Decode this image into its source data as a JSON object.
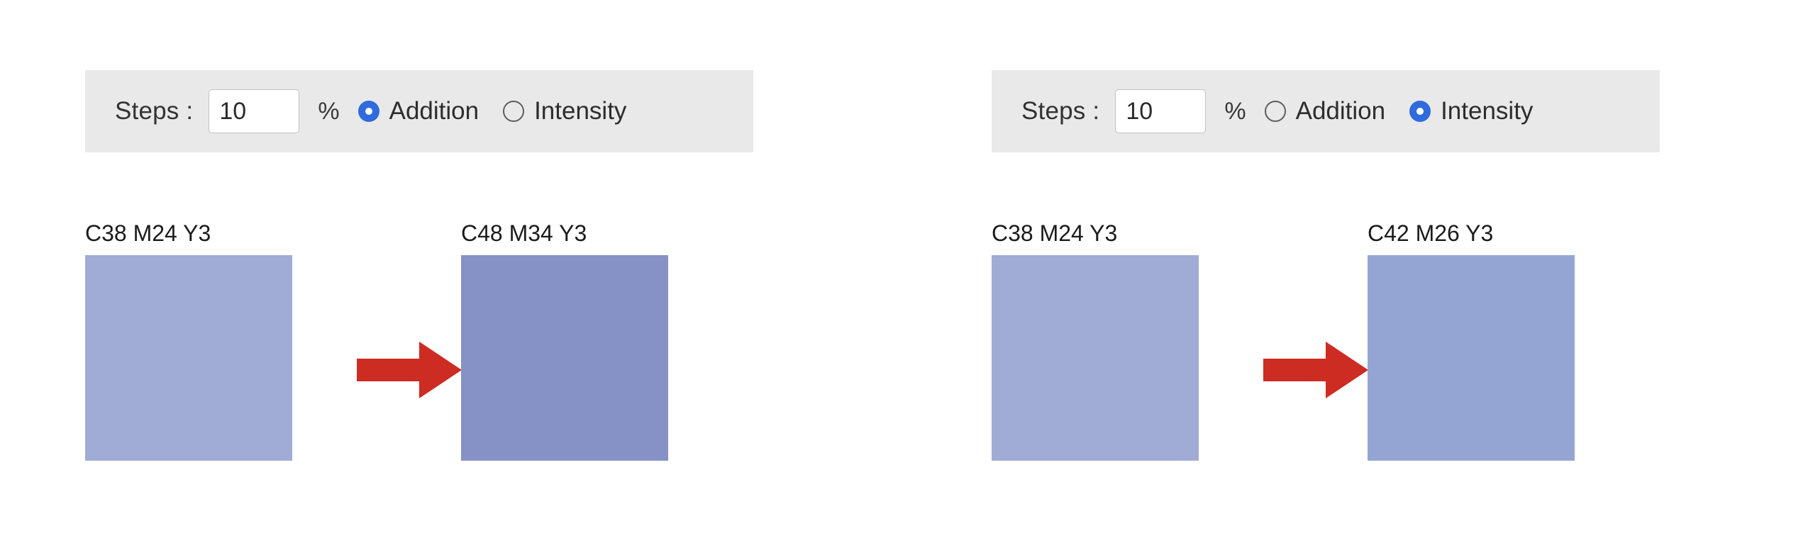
{
  "page": {
    "background": "#ffffff",
    "accent_blue": "#2f6bdc",
    "arrow_red": "#cc2c22",
    "bar_background": "#e9e9e9"
  },
  "panels": [
    {
      "id": "addition-panel",
      "controls": {
        "steps_label": "Steps :",
        "steps_value": "10",
        "steps_placeholder": "10",
        "percent_symbol": "%",
        "options": [
          {
            "label": "Addition",
            "selected": true
          },
          {
            "label": "Intensity",
            "selected": false
          }
        ]
      },
      "swatches": {
        "source": {
          "caption": "C38 M24 Y3",
          "color": "#a0acd5"
        },
        "result": {
          "caption": "C48 M34 Y3",
          "color": "#8692c6"
        },
        "arrow": "arrow-right-icon"
      }
    },
    {
      "id": "intensity-panel",
      "controls": {
        "steps_label": "Steps :",
        "steps_value": "10",
        "steps_placeholder": "10",
        "percent_symbol": "%",
        "options": [
          {
            "label": "Addition",
            "selected": false
          },
          {
            "label": "Intensity",
            "selected": true
          }
        ]
      },
      "swatches": {
        "source": {
          "caption": "C38 M24 Y3",
          "color": "#a0acd5"
        },
        "result": {
          "caption": "C42 M26 Y3",
          "color": "#95a5d3"
        },
        "arrow": "arrow-right-icon"
      }
    }
  ]
}
